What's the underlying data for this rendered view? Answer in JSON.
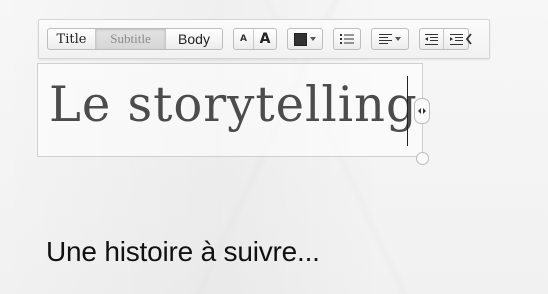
{
  "toolbar": {
    "text_styles": [
      {
        "label": "Title",
        "selected": false
      },
      {
        "label": "Subtitle",
        "selected": true
      },
      {
        "label": "Body",
        "selected": false
      }
    ],
    "font_size": {
      "decrease_label": "A",
      "increase_label": "A"
    },
    "text_color": {
      "icon": "color-swatch-icon",
      "value": "#333333"
    },
    "list": {
      "icon": "bullet-list-icon"
    },
    "alignment": {
      "icon": "align-left-icon"
    },
    "indent": {
      "decrease_icon": "outdent-icon",
      "increase_icon": "indent-icon"
    },
    "collapse": {
      "icon": "chevron-left-icon"
    }
  },
  "editor": {
    "heading_text": "Le storytelling",
    "resize_horizontal_icon": "horizontal-resize-icon",
    "resize_vertical_icon": "resize-handle-icon"
  },
  "content": {
    "body_text": "Une histoire à suivre..."
  },
  "colors": {
    "toolbar_bg": "#f4f4f4",
    "border": "#cfcfcf",
    "heading_text": "#4c4c4c",
    "body_text": "#111111"
  }
}
